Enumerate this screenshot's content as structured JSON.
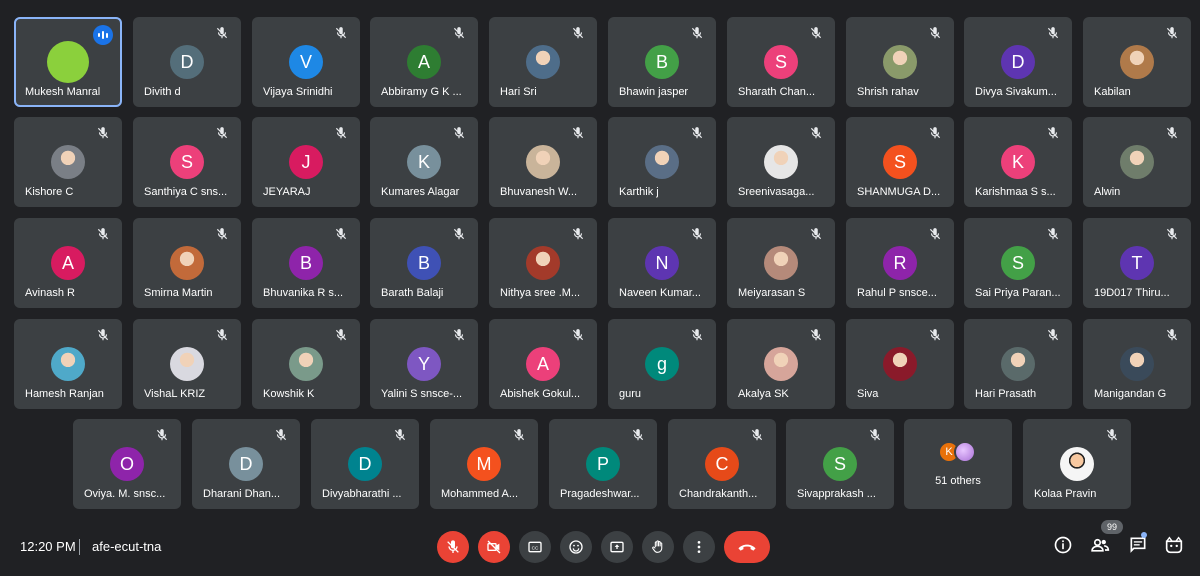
{
  "participants": [
    {
      "name": "Mukesh Manral",
      "initial": "",
      "color": "#8bd03c",
      "speaking": true
    },
    {
      "name": "Divith d",
      "initial": "D",
      "color": "#546e7a"
    },
    {
      "name": "Vijaya Srinidhi",
      "initial": "V",
      "color": "#1e88e5"
    },
    {
      "name": "Abbiramy G K ...",
      "initial": "A",
      "color": "#2e7d32"
    },
    {
      "name": "Hari Sri",
      "initial": "",
      "color": "#4e6d8a",
      "photo": true
    },
    {
      "name": "Bhawin jasper",
      "initial": "B",
      "color": "#43a047"
    },
    {
      "name": "Sharath Chan...",
      "initial": "S",
      "color": "#ec407a"
    },
    {
      "name": "Shrish rahav",
      "initial": "",
      "color": "#8a9a6a",
      "photo": true
    },
    {
      "name": "Divya Sivakum...",
      "initial": "D",
      "color": "#5e35b1"
    },
    {
      "name": "Kabilan",
      "initial": "",
      "color": "#b07a4a",
      "photo": true
    },
    {
      "name": "Kishore C",
      "initial": "",
      "color": "#7a7f86",
      "photo": true
    },
    {
      "name": "Santhiya C sns...",
      "initial": "S",
      "color": "#ec407a"
    },
    {
      "name": "JEYARAJ",
      "initial": "J",
      "color": "#d81b60"
    },
    {
      "name": "Kumares Alagar",
      "initial": "K",
      "color": "#78909c"
    },
    {
      "name": "Bhuvanesh W...",
      "initial": "",
      "color": "#c9b49a",
      "photo": true
    },
    {
      "name": "Karthik j",
      "initial": "",
      "color": "#5a6e86",
      "photo": true
    },
    {
      "name": "Sreenivasaga...",
      "initial": "",
      "color": "#e6e6e6",
      "photo": true
    },
    {
      "name": "SHANMUGA D...",
      "initial": "S",
      "color": "#f4511e"
    },
    {
      "name": "Karishmaa S s...",
      "initial": "K",
      "color": "#ec407a"
    },
    {
      "name": "Alwin",
      "initial": "",
      "color": "#6f7d6b",
      "photo": true
    },
    {
      "name": "Avinash R",
      "initial": "A",
      "color": "#d81b60"
    },
    {
      "name": "Smirna Martin",
      "initial": "",
      "color": "#c26a3a",
      "photo": true
    },
    {
      "name": "Bhuvanika R s...",
      "initial": "B",
      "color": "#8e24aa"
    },
    {
      "name": "Barath Balaji",
      "initial": "B",
      "color": "#3f51b5"
    },
    {
      "name": "Nithya sree .M...",
      "initial": "",
      "color": "#a33a2a",
      "photo": true
    },
    {
      "name": "Naveen Kumar...",
      "initial": "N",
      "color": "#5e35b1"
    },
    {
      "name": "Meiyarasan S",
      "initial": "",
      "color": "#b58a7a",
      "photo": true
    },
    {
      "name": "Rahul P snsce...",
      "initial": "R",
      "color": "#8e24aa"
    },
    {
      "name": "Sai Priya Paran...",
      "initial": "S",
      "color": "#43a047"
    },
    {
      "name": "19D017 Thiru...",
      "initial": "T",
      "color": "#5e35b1"
    },
    {
      "name": "Hamesh Ranjan",
      "initial": "",
      "color": "#4fa9c9",
      "photo": true
    },
    {
      "name": "VishaL KRIZ",
      "initial": "",
      "color": "#d9d9e0",
      "photo": true
    },
    {
      "name": "Kowshik K",
      "initial": "",
      "color": "#7a9a8a",
      "photo": true
    },
    {
      "name": "Yalini S snsce-...",
      "initial": "Y",
      "color": "#7e57c2"
    },
    {
      "name": "Abishek Gokul...",
      "initial": "A",
      "color": "#ec407a"
    },
    {
      "name": "guru",
      "initial": "g",
      "color": "#00897b"
    },
    {
      "name": "Akalya SK",
      "initial": "",
      "color": "#d6a59a",
      "photo": true
    },
    {
      "name": "Siva",
      "initial": "",
      "color": "#8a1a2a",
      "photo": true
    },
    {
      "name": "Hari Prasath",
      "initial": "",
      "color": "#5a6a6a",
      "photo": true
    },
    {
      "name": "Manigandan G",
      "initial": "",
      "color": "#3a4a5a",
      "photo": true
    },
    {
      "name": "Oviya. M. snsc...",
      "initial": "O",
      "color": "#8e24aa"
    },
    {
      "name": "Dharani Dhan...",
      "initial": "D",
      "color": "#78909c"
    },
    {
      "name": "Divyabharathi ...",
      "initial": "D",
      "color": "#00838f"
    },
    {
      "name": "Mohammed A...",
      "initial": "M",
      "color": "#f4511e"
    },
    {
      "name": "Pragadeshwar...",
      "initial": "P",
      "color": "#00897b"
    },
    {
      "name": "Chandrakanth...",
      "initial": "C",
      "color": "#e64a19"
    },
    {
      "name": "Sivapprakash ...",
      "initial": "S",
      "color": "#43a047"
    }
  ],
  "others_tile": {
    "label": "51 others",
    "initial": "K"
  },
  "last_tile": {
    "name": "Kolaa Pravin",
    "color": "#f5f5f5"
  },
  "bottom_bar": {
    "time": "12:20 PM",
    "meeting_code": "afe-ecut-tna",
    "participant_count": "99"
  },
  "icons": {
    "mic": "mic-off-icon",
    "camera": "camera-off-icon",
    "captions": "captions-icon",
    "emoji": "emoji-icon",
    "present": "present-icon",
    "hand": "raise-hand-icon",
    "more": "more-options-icon",
    "end": "end-call-icon",
    "info": "info-icon",
    "people": "people-icon",
    "chat": "chat-icon",
    "activities": "activities-icon"
  },
  "colors": {
    "background": "#202124",
    "tile": "#3c4043",
    "danger": "#ea4335",
    "accent": "#8ab4f8"
  }
}
